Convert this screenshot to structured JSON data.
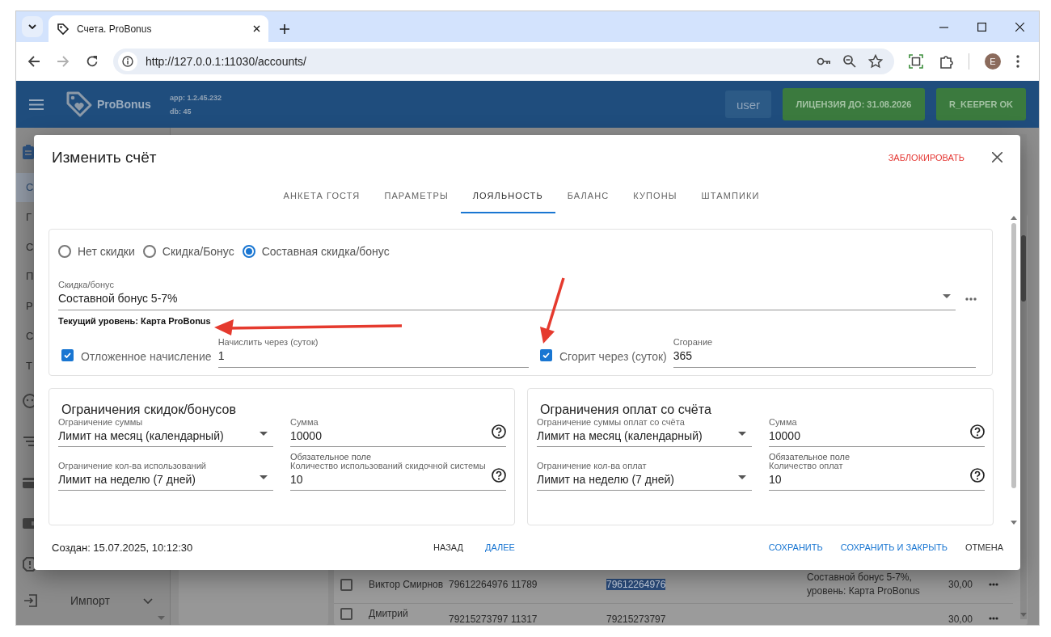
{
  "browser": {
    "tab_title": "Счета. ProBonus",
    "url": "http://127.0.0.1:11030/accounts/",
    "avatar": "E"
  },
  "header": {
    "brand": "ProBonus",
    "app_version": "app: 1.2.45.232",
    "db_version": "db: 45",
    "user": "user",
    "license": "ЛИЦЕНЗИЯ ДО: 31.08.2026",
    "rkeeper_status": "R_KEEPER OK"
  },
  "sidebar": {
    "items": [
      {
        "label": "С",
        "selected": true
      },
      {
        "label": "Г",
        "selected": false
      },
      {
        "label": "С",
        "selected": false
      },
      {
        "label": "П",
        "selected": false
      },
      {
        "label": "Р",
        "selected": false
      },
      {
        "label": "С",
        "selected": false
      },
      {
        "label": "Т",
        "selected": false
      }
    ],
    "import_label": "Импорт"
  },
  "table": {
    "rows": [
      {
        "checked": false,
        "name": "Виктор Смирнов",
        "phone": "79612264976",
        "number": "11789",
        "card": "79612264976",
        "card_selected": true,
        "bonus": "Составной бонус 5-7%, уровень: Карта ProBonus",
        "amount": "30,00"
      },
      {
        "checked": false,
        "name": "Дмитрий",
        "phone": "79215273797",
        "number": "11317",
        "card": "79215273797",
        "card_selected": false,
        "amount": "30,00"
      }
    ]
  },
  "dialog": {
    "title": "Изменить счёт",
    "block_action": "ЗАБЛОКИРОВАТЬ",
    "tabs": [
      {
        "label": "АНКЕТА ГОСТЯ",
        "selected": false
      },
      {
        "label": "ПАРАМЕТРЫ",
        "selected": false
      },
      {
        "label": "ЛОЯЛЬНОСТЬ",
        "selected": true
      },
      {
        "label": "БАЛАНС",
        "selected": false
      },
      {
        "label": "КУПОНЫ",
        "selected": false
      },
      {
        "label": "ШТАМПИКИ",
        "selected": false
      }
    ],
    "loyalty": {
      "modes": [
        {
          "label": "Нет скидки",
          "selected": false
        },
        {
          "label": "Скидка/Бонус",
          "selected": false
        },
        {
          "label": "Составная скидка/бонус",
          "selected": true
        }
      ],
      "bonus_field": {
        "label": "Скидка/бонус",
        "value": "Составной бонус 5-7%"
      },
      "current_level": "Текущий уровень: Карта ProBonus",
      "options": [
        {
          "label": "Отложенное начисление",
          "checked": true,
          "field_label": "Начислить через (суток)",
          "field_value": "1"
        },
        {
          "label": "Сгорит через (суток)",
          "checked": true,
          "field_label": "Сгорание",
          "field_value": "365"
        }
      ]
    },
    "limit_cards": [
      {
        "title": "Ограничения скидок/бонусов",
        "rows": [
          {
            "select_label": "Ограничение суммы",
            "select_value": "Лимит на месяц (календарный)",
            "field_label": "Сумма",
            "field_value": "10000",
            "helper": "Обязательное поле"
          },
          {
            "select_label": "Ограничение кол-ва использований",
            "select_value": "Лимит на неделю (7 дней)",
            "field_label": "Количество использований скидочной системы",
            "field_value": "10"
          }
        ]
      },
      {
        "title": "Ограничения оплат со счёта",
        "rows": [
          {
            "select_label": "Ограничение суммы оплат со счёта",
            "select_value": "Лимит на месяц (календарный)",
            "field_label": "Сумма",
            "field_value": "10000",
            "helper": "Обязательное поле"
          },
          {
            "select_label": "Ограничение кол-ва оплат",
            "select_value": "Лимит на неделю (7 дней)",
            "field_label": "Количество оплат",
            "field_value": "10"
          }
        ]
      }
    ],
    "created": "Создан: 15.07.2025, 10:12:30",
    "nav_buttons": [
      {
        "label": "НАЗАД",
        "kind": "plain"
      },
      {
        "label": "ДАЛЕЕ",
        "kind": "primary"
      }
    ],
    "action_buttons": [
      {
        "label": "СОХРАНИТЬ",
        "kind": "primary"
      },
      {
        "label": "СОХРАНИТЬ И ЗАКРЫТЬ",
        "kind": "primary"
      },
      {
        "label": "ОТМЕНА",
        "kind": "plain"
      }
    ]
  }
}
